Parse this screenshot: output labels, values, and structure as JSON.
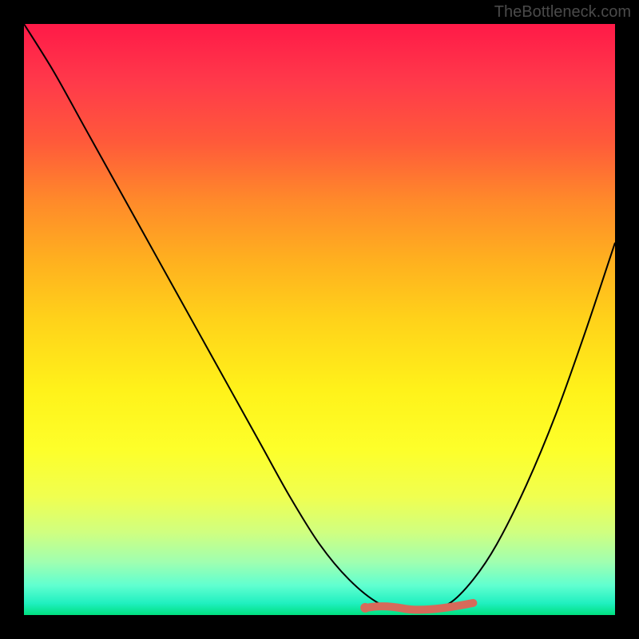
{
  "watermark": "TheBottleneck.com",
  "chart_data": {
    "type": "line",
    "title": "",
    "xlabel": "",
    "ylabel": "",
    "xlim": [
      0,
      1
    ],
    "ylim": [
      0,
      1
    ],
    "series": [
      {
        "name": "curve",
        "x": [
          0.0,
          0.05,
          0.1,
          0.15,
          0.2,
          0.25,
          0.3,
          0.35,
          0.4,
          0.45,
          0.5,
          0.55,
          0.6,
          0.64,
          0.68,
          0.72,
          0.76,
          0.8,
          0.85,
          0.9,
          0.95,
          1.0
        ],
        "y": [
          1.0,
          0.92,
          0.83,
          0.74,
          0.65,
          0.56,
          0.47,
          0.38,
          0.29,
          0.2,
          0.12,
          0.06,
          0.02,
          0.01,
          0.01,
          0.02,
          0.06,
          0.12,
          0.22,
          0.34,
          0.48,
          0.63
        ]
      }
    ],
    "highlight": {
      "xrange": [
        0.58,
        0.76
      ],
      "y": 0.015
    },
    "background_gradient": {
      "top": "#ff1a48",
      "middle": "#fff21a",
      "bottom": "#00e080"
    }
  }
}
